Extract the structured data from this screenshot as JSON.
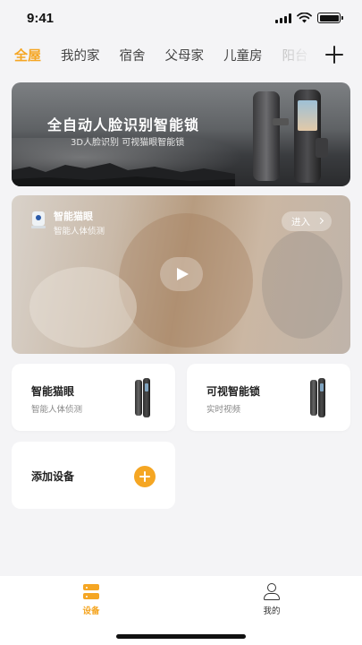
{
  "status_bar": {
    "time": "9:41"
  },
  "tabs": {
    "items": [
      "全屋",
      "我的家",
      "宿舍",
      "父母家",
      "儿童房",
      "阳台"
    ],
    "active": "全屋",
    "add_icon": "plus-icon"
  },
  "banner": {
    "title": "全自动人脸识别智能锁",
    "subtitle": "3D人脸识别 可视猫眼智能锁"
  },
  "video_card": {
    "device_name": "智能猫眼",
    "status": "智能人体侦测",
    "enter_label": "进入",
    "play_icon": "play-icon"
  },
  "devices": [
    {
      "name": "智能猫眼",
      "desc": "智能人体侦测"
    },
    {
      "name": "可视智能锁",
      "desc": "实时视频"
    }
  ],
  "add_device": {
    "label": "添加设备"
  },
  "bottom_nav": {
    "items": [
      {
        "label": "设备",
        "icon": "devices-icon",
        "active": true
      },
      {
        "label": "我的",
        "icon": "profile-icon",
        "active": false
      }
    ]
  },
  "colors": {
    "accent": "#f5a623",
    "background": "#f4f4f6"
  }
}
